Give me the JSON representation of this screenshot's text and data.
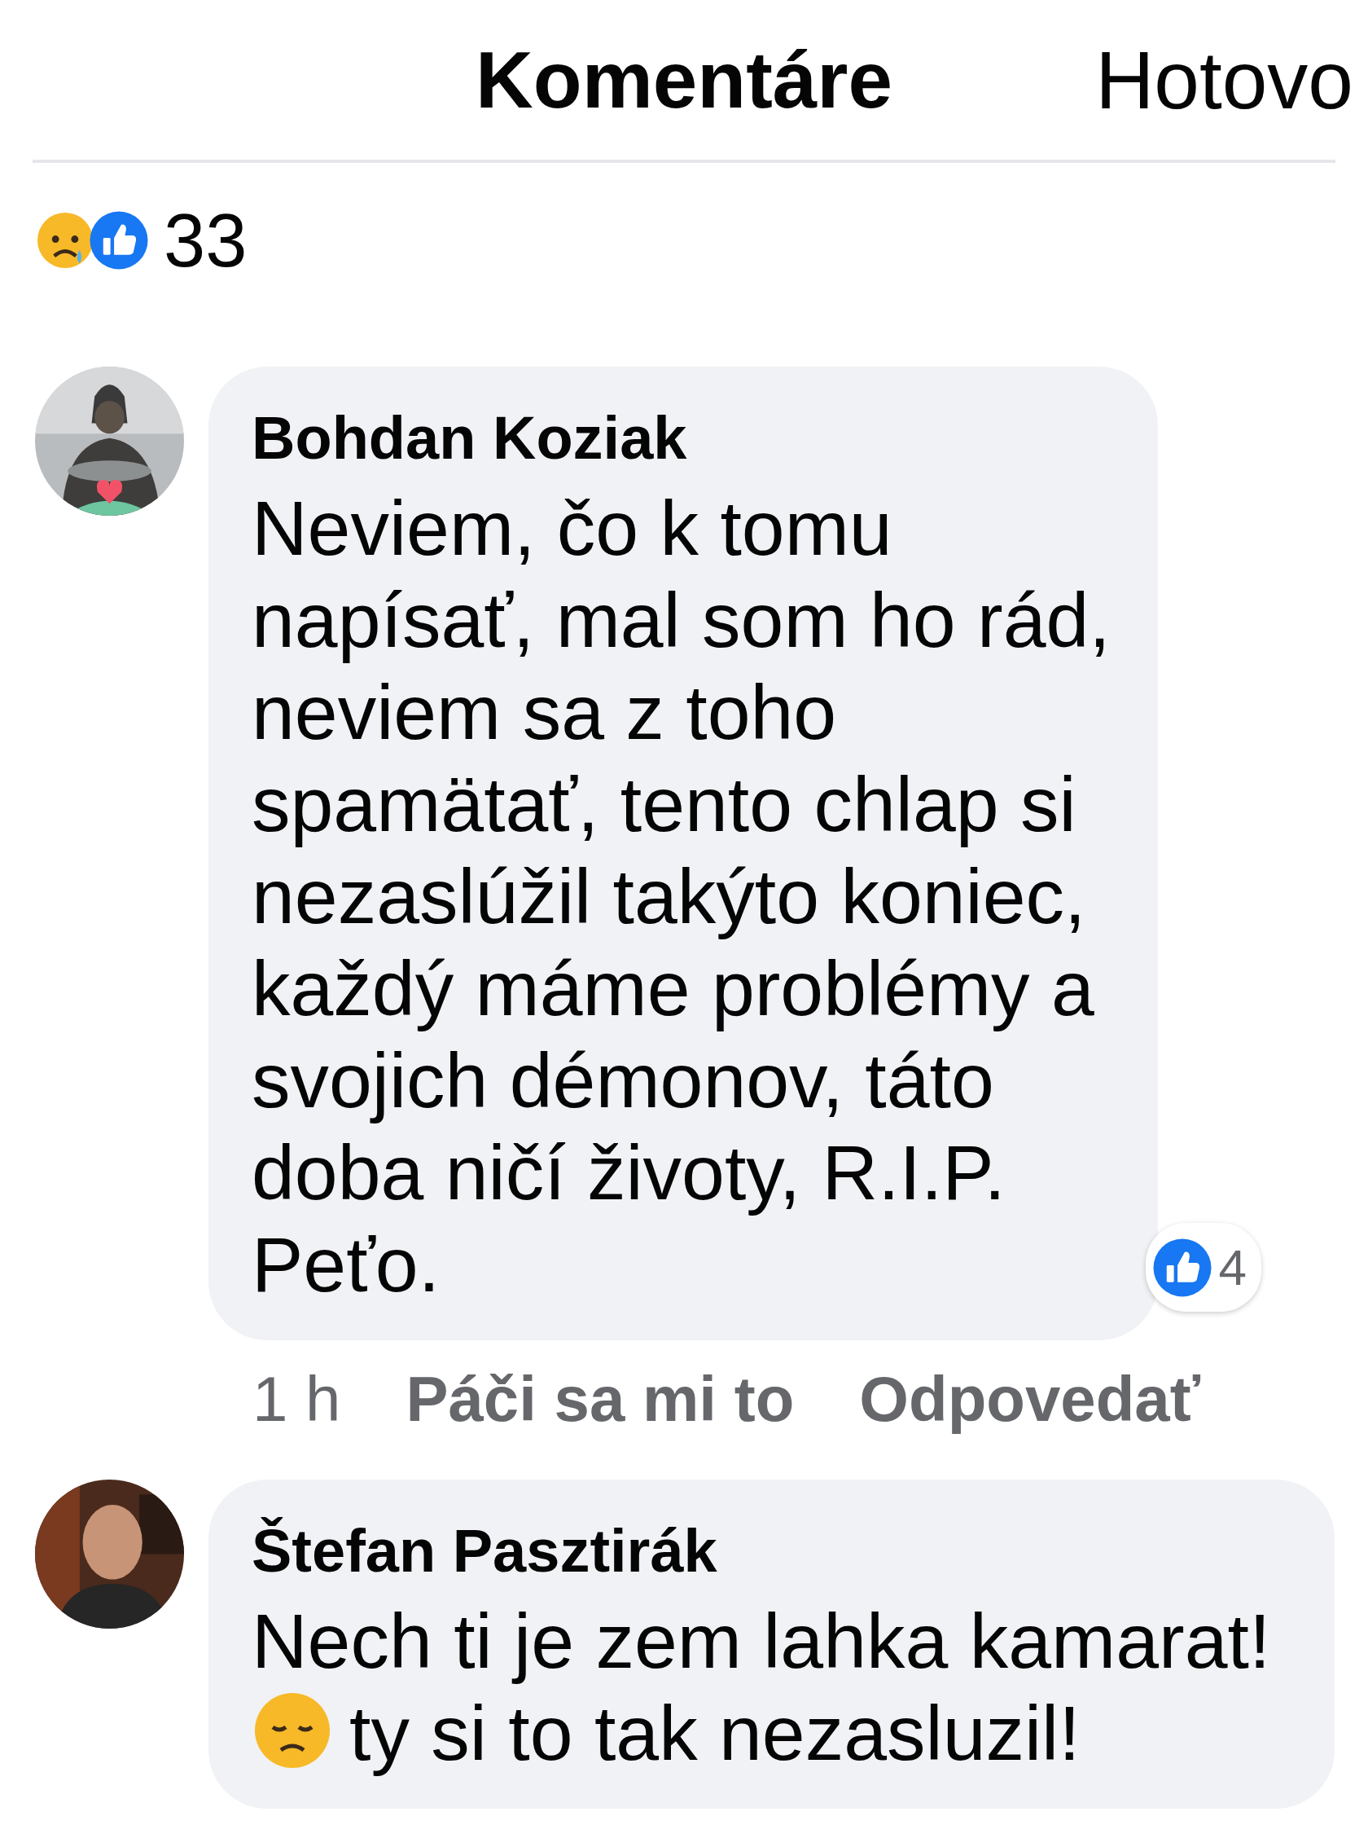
{
  "header": {
    "title": "Komentáre",
    "done_button": "Hotovo"
  },
  "reactions": {
    "count": "33"
  },
  "comments": [
    {
      "author": "Bohdan Koziak",
      "text": "Neviem, čo k tomu napísať, mal som ho rád, neviem sa z toho spamätať, tento chlap si nezaslúžil takýto koniec, každý máme problémy a svojich démonov, táto doba ničí životy, R.I.P. Peťo.",
      "like_count": "4",
      "time": "1 h",
      "like_action": "Páči sa mi to",
      "reply_action": "Odpovedať"
    },
    {
      "author": "Štefan Pasztirák",
      "text": "Nech ti je zem lahka kamarat!",
      "continuation": "ty si to tak nezasluzil!"
    }
  ]
}
